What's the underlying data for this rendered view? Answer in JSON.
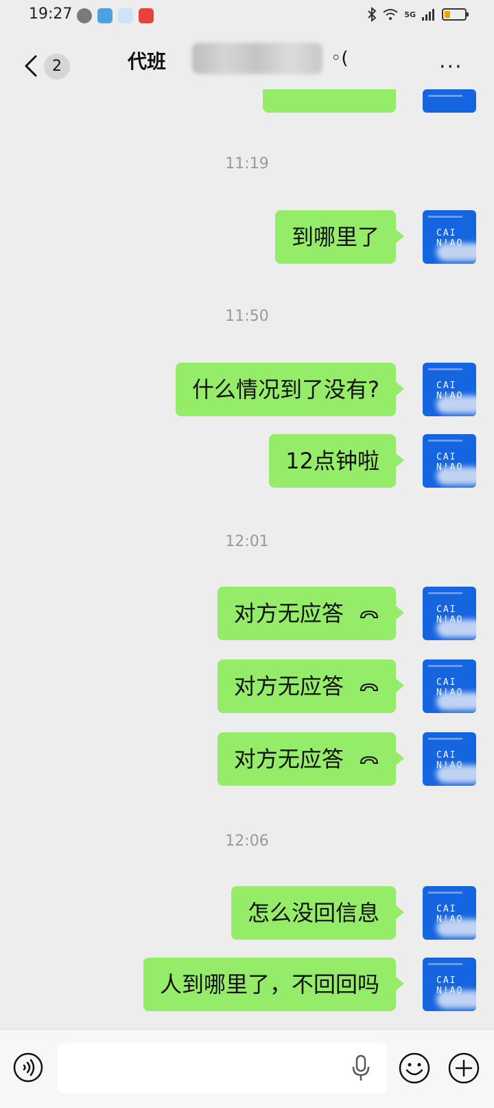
{
  "status_bar": {
    "time": "19:27",
    "network": "5G"
  },
  "header": {
    "back_count": "2",
    "title": "代班",
    "title_deco": "◦(",
    "more": "···"
  },
  "avatar": {
    "line1": "CAI",
    "line2": "N!AO"
  },
  "messages": [
    {
      "type": "time",
      "text": "11:19"
    },
    {
      "type": "sent",
      "text": "到哪里了"
    },
    {
      "type": "time",
      "text": "11:50"
    },
    {
      "type": "sent",
      "text": "什么情况到了没有?"
    },
    {
      "type": "sent",
      "text": "12点钟啦"
    },
    {
      "type": "time",
      "text": "12:01"
    },
    {
      "type": "call",
      "text": "对方无应答"
    },
    {
      "type": "call",
      "text": "对方无应答"
    },
    {
      "type": "call",
      "text": "对方无应答"
    },
    {
      "type": "time",
      "text": "12:06"
    },
    {
      "type": "sent",
      "text": "怎么没回信息"
    },
    {
      "type": "sent",
      "text": "人到哪里了，不回回吗"
    }
  ],
  "colors": {
    "bubble": "#95ec69",
    "avatar": "#1565e0",
    "background": "#ededed"
  },
  "icons": {
    "back": "chevron-left-icon",
    "voice": "voice-icon",
    "mic": "mic-icon",
    "emoji": "emoji-icon",
    "plus": "plus-icon",
    "call": "missed-call-icon"
  }
}
